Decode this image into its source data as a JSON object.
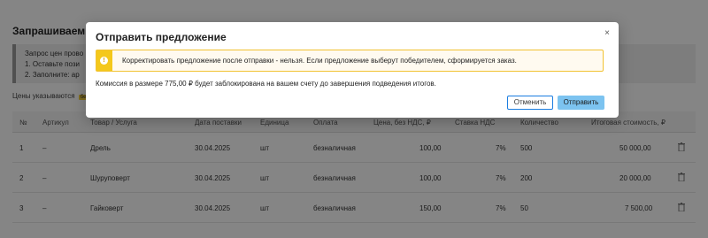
{
  "page": {
    "section_title": "Запрашиваемы",
    "info_lines": [
      "Запрос цен прово",
      "1. Оставьте пози",
      "2. Заполните: ар"
    ],
    "prices_note": "Цены указываются",
    "prices_badge": "без НДС"
  },
  "table": {
    "headers": {
      "num": "№",
      "article": "Артикул",
      "product": "Товар / Услуга",
      "delivery": "Дата поставки",
      "unit": "Единица",
      "payment": "Оплата",
      "price": "Цена, без НДС, ₽",
      "vat": "Ставка НДС",
      "qty": "Количество",
      "total": "Итоговая стоимость, ₽"
    },
    "rows": [
      {
        "num": "1",
        "article": "–",
        "product": "Дрель",
        "delivery": "30.04.2025",
        "unit": "шт",
        "payment": "безналичная",
        "price": "100,00",
        "vat": "7%",
        "qty": "500",
        "total": "50 000,00"
      },
      {
        "num": "2",
        "article": "–",
        "product": "Шуруповерт",
        "delivery": "30.04.2025",
        "unit": "шт",
        "payment": "безналичная",
        "price": "100,00",
        "vat": "7%",
        "qty": "200",
        "total": "20 000,00"
      },
      {
        "num": "3",
        "article": "–",
        "product": "Гайковерт",
        "delivery": "30.04.2025",
        "unit": "шт",
        "payment": "безналичная",
        "price": "150,00",
        "vat": "7%",
        "qty": "50",
        "total": "7 500,00"
      }
    ]
  },
  "modal": {
    "title": "Отправить предложение",
    "close": "×",
    "warning_icon": "!",
    "warning": "Корректировать предложение после отправки - нельзя. Если предложение выберут победителем, сформируется заказ.",
    "commission": "Комиссия в размере 775,00 ₽ будет заблокирована на вашем счету до завершения подведения итогов.",
    "cancel_label": "Отменить",
    "send_label": "Отправить"
  },
  "colors": {
    "overlay": "#000000",
    "warning_accent": "#f4c81b",
    "primary": "#7cc3f0",
    "cancel_border": "#1a7de0"
  }
}
